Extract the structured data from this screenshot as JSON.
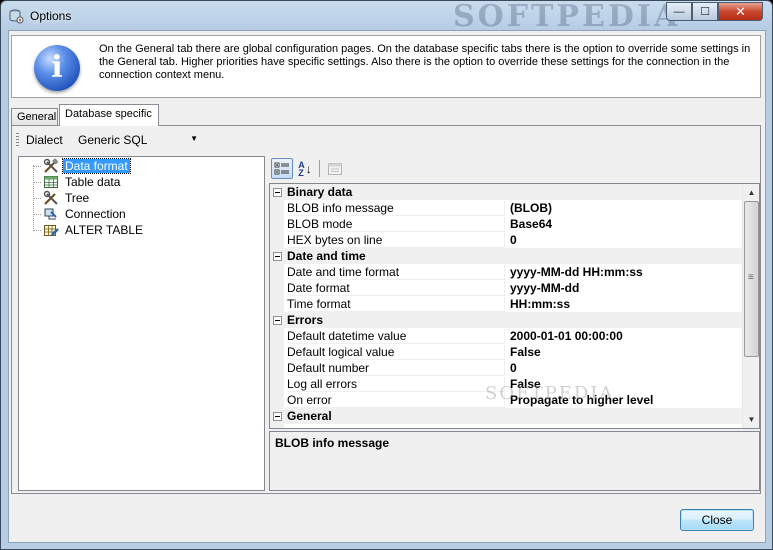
{
  "window": {
    "title": "Options",
    "watermark": "SOFTPEDIA",
    "controls": {
      "minimize": "—",
      "maximize": "☐",
      "close": "✕"
    }
  },
  "info": {
    "icon": "info-icon",
    "glyph": "i",
    "text": "On the General tab there are global configuration pages. On the database specific tabs there is the option to override some settings in the General tab. Higher priorities have specific settings. Also there is the option to override these settings for the connection in the connection context menu."
  },
  "tabs": [
    {
      "label": "General",
      "active": false
    },
    {
      "label": "Database specific",
      "active": true
    }
  ],
  "dialect": {
    "label": "Dialect",
    "value": "Generic SQL"
  },
  "tree": {
    "items": [
      {
        "label": "Data format",
        "icon": "tools-icon",
        "selected": true
      },
      {
        "label": "Table data",
        "icon": "grid-icon",
        "selected": false
      },
      {
        "label": "Tree",
        "icon": "tools-icon",
        "selected": false
      },
      {
        "label": "Connection",
        "icon": "connection-icon",
        "selected": false
      },
      {
        "label": "ALTER TABLE",
        "icon": "table-edit-icon",
        "selected": false
      }
    ]
  },
  "property_toolbar": {
    "categorized": "categorized-icon",
    "alphabetical": "sort-az-icon",
    "alpha_top": "A",
    "alpha_bottom": "Z",
    "property_pages": "property-pages-icon"
  },
  "grid": {
    "categories": [
      {
        "name": "Binary data",
        "props": [
          {
            "name": "BLOB info message",
            "value": "(BLOB)"
          },
          {
            "name": "BLOB mode",
            "value": "Base64"
          },
          {
            "name": "HEX bytes on line",
            "value": "0"
          }
        ]
      },
      {
        "name": "Date and time",
        "props": [
          {
            "name": "Date and time format",
            "value": "yyyy-MM-dd HH:mm:ss"
          },
          {
            "name": "Date format",
            "value": "yyyy-MM-dd"
          },
          {
            "name": "Time format",
            "value": "HH:mm:ss"
          }
        ]
      },
      {
        "name": "Errors",
        "props": [
          {
            "name": "Default datetime value",
            "value": "2000-01-01 00:00:00"
          },
          {
            "name": "Default logical value",
            "value": "False"
          },
          {
            "name": "Default number",
            "value": "0"
          },
          {
            "name": "Log all errors",
            "value": "False"
          },
          {
            "name": "On error",
            "value": "Propagate to higher level"
          }
        ]
      },
      {
        "name": "General",
        "props": []
      }
    ],
    "watermark": "SOFTPEDIA"
  },
  "description": {
    "title": "BLOB info message"
  },
  "buttons": {
    "close": "Close"
  }
}
